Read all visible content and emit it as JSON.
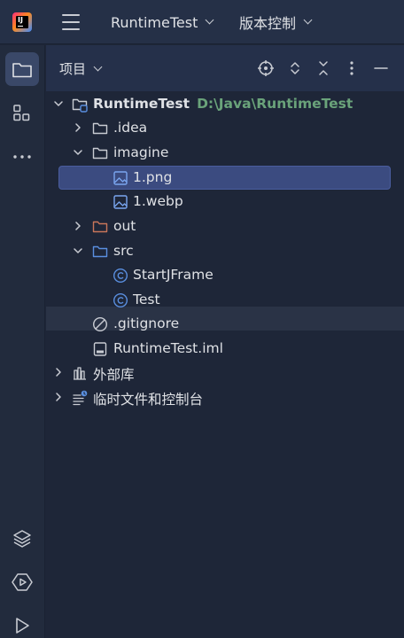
{
  "titlebar": {
    "project_menu": "RuntimeTest",
    "vcs_menu": "版本控制"
  },
  "panel": {
    "title": "项目"
  },
  "tree": {
    "root_name": "RuntimeTest",
    "root_path": "D:\\Java\\RuntimeTest",
    "items": [
      {
        "label": ".idea"
      },
      {
        "label": "imagine"
      },
      {
        "label": "1.png"
      },
      {
        "label": "1.webp"
      },
      {
        "label": "out"
      },
      {
        "label": "src"
      },
      {
        "label": "StartJFrame"
      },
      {
        "label": "Test"
      },
      {
        "label": ".gitignore"
      },
      {
        "label": "RuntimeTest.iml"
      },
      {
        "label": "外部库"
      },
      {
        "label": "临时文件和控制台"
      }
    ]
  },
  "colors": {
    "background": "#1e2638",
    "selection": "#3b4b80",
    "folder_excluded": "#c8755a",
    "folder_source": "#5a8fe0",
    "path_text": "#6aa37a"
  },
  "icons": [
    "jetbrains-logo-icon",
    "hamburger-menu-icon",
    "folder-icon",
    "structure-icon",
    "more-icon",
    "layers-icon",
    "services-icon",
    "run-icon",
    "crosshair-icon",
    "expand-collapse-icon",
    "collapse-all-icon",
    "kebab-icon",
    "minimize-icon"
  ]
}
